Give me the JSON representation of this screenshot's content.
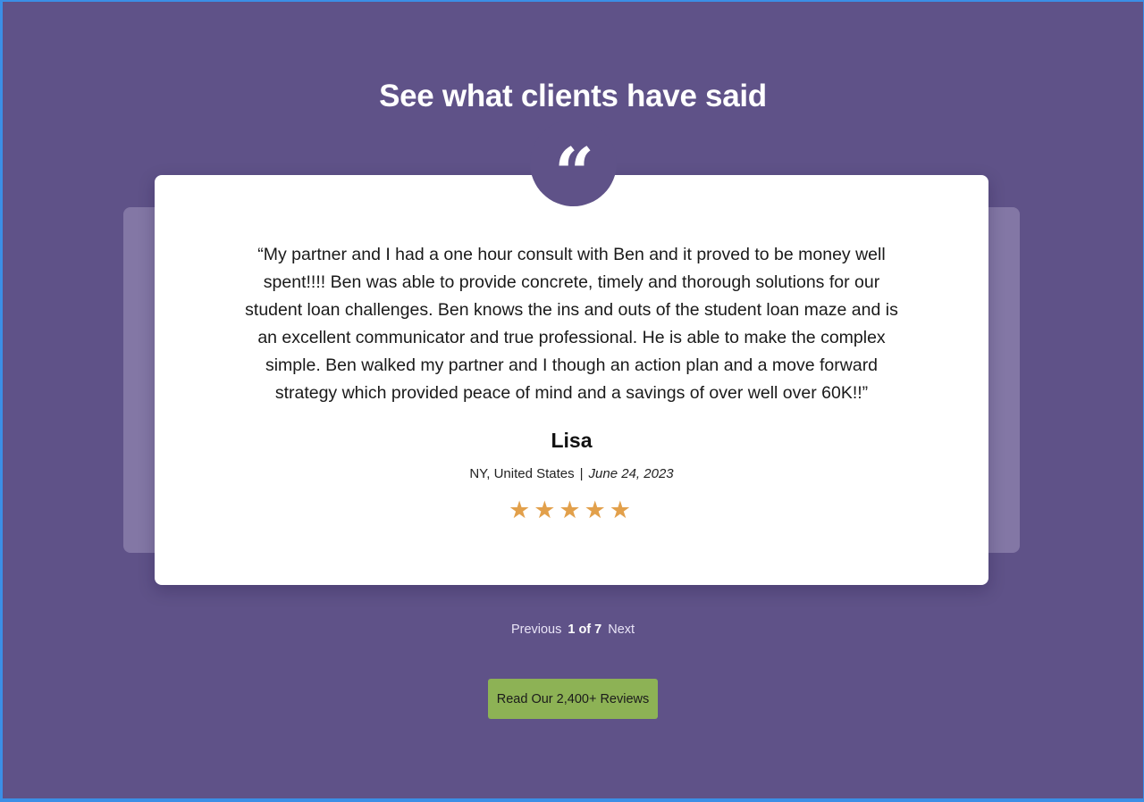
{
  "heading": "See what clients have said",
  "quote_icon": "quote-mark-icon",
  "quote_glyph": "“",
  "review": {
    "text": "“My partner and I had a one hour consult with Ben and it proved to be money well spent!!!! Ben was able to provide concrete, timely and thorough solutions for our student loan challenges. Ben knows the ins and outs of the student loan maze and is an excellent communicator and true professional. He is able to make the complex simple. Ben walked my partner and I though an action plan and a move forward strategy which provided peace of mind and a savings of over well over 60K!!”",
    "name": "Lisa",
    "location": "NY, United States",
    "separator": "|",
    "date": "June 24, 2023",
    "rating": 5,
    "stars": "★★★★★"
  },
  "pager": {
    "previous": "Previous",
    "count": "1 of 7",
    "next": "Next"
  },
  "cta": {
    "label": "Read Our 2,400+ Reviews"
  },
  "colors": {
    "background": "#5f5288",
    "card": "#ffffff",
    "back_card": "#8377a5",
    "star": "#e2a04b",
    "button": "#8db255",
    "frame": "#3b8fe6"
  }
}
